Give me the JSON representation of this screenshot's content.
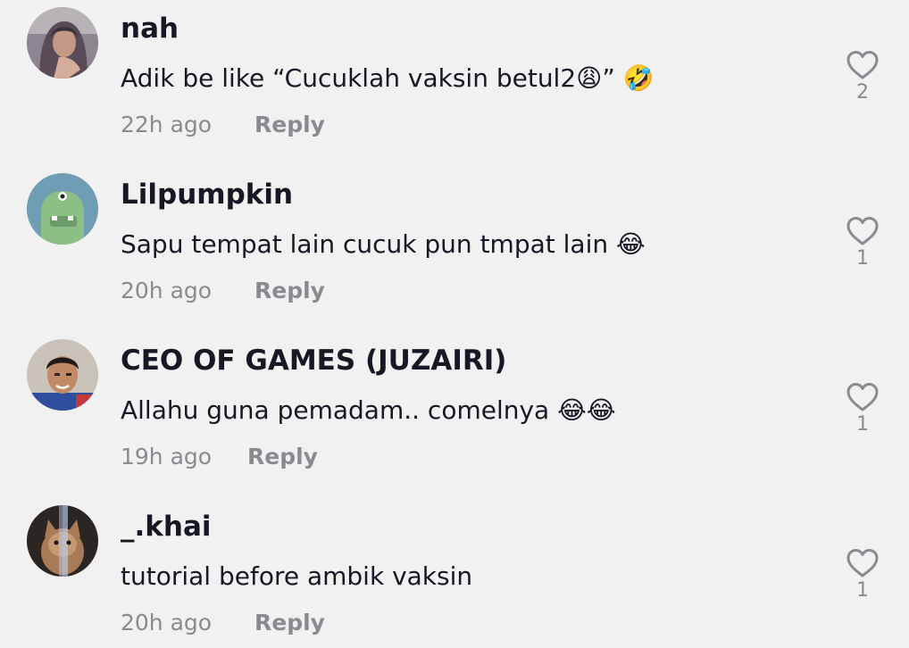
{
  "comments": [
    {
      "username": "nah",
      "text_before": "Adik be like “Cucuklah vaksin betul2",
      "text_emoji1": "😩",
      "text_after": "” ",
      "text_emoji2": "🤣",
      "time": "22h ago",
      "reply_label": "Reply",
      "likes": "2",
      "avatar_icon": "avatar-hijab"
    },
    {
      "username": "Lilpumpkin",
      "text_before": "Sapu tempat lain cucuk pun tmpat lain ",
      "text_emoji1": "😂",
      "time": "20h ago",
      "reply_label": "Reply",
      "likes": "1",
      "avatar_icon": "avatar-green-monster"
    },
    {
      "username": "CEO OF GAMES (JUZAIRI)",
      "text_before": "Allahu guna pemadam.. comelnya ",
      "text_emoji1": "😂😂",
      "time": "19h ago",
      "reply_label": "Reply",
      "likes": "1",
      "avatar_icon": "avatar-photo"
    },
    {
      "username": "_.khai",
      "text_before": "tutorial before ambik vaksin",
      "time": "20h ago",
      "reply_label": "Reply",
      "likes": "1",
      "avatar_icon": "avatar-cat-photo"
    }
  ],
  "colors": {
    "background": "#f1f1f2",
    "primary_text": "#161823",
    "secondary_text": "#8a8b91"
  },
  "icons": {
    "like": "heart-outline-icon"
  }
}
